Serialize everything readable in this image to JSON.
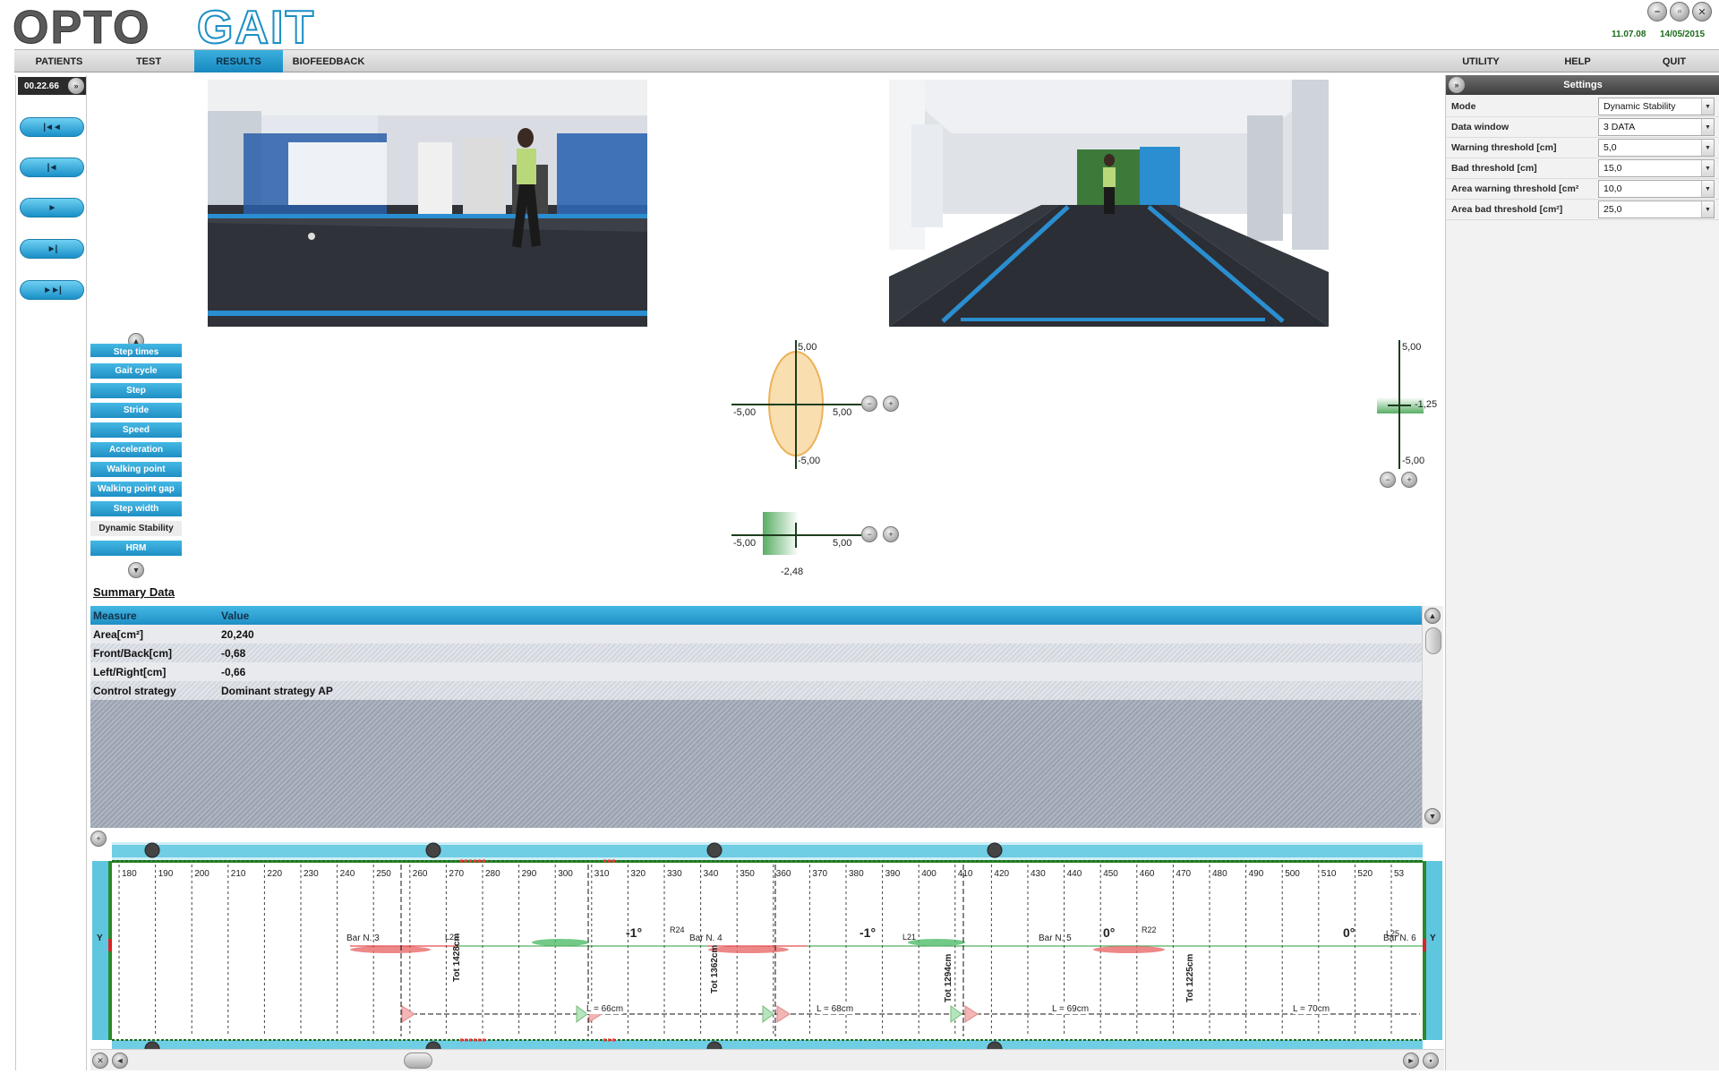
{
  "app": {
    "logo_text": "OPTOGAIT",
    "version": "11.07.08",
    "date": "14/05/2015"
  },
  "menu": {
    "left": [
      "PATIENTS",
      "TEST",
      "RESULTS",
      "BIOFEEDBACK"
    ],
    "right": [
      "UTILITY",
      "HELP",
      "QUIT"
    ],
    "active": "RESULTS"
  },
  "player": {
    "time": "00.22.66",
    "controls": [
      "|◄◄",
      "|◄",
      "►",
      "►|",
      "►►|"
    ]
  },
  "measures": {
    "items": [
      "Step times",
      "Gait cycle",
      "Step",
      "Stride",
      "Speed",
      "Acceleration",
      "Walking point",
      "Walking point gap",
      "Step width",
      "Dynamic Stability",
      "HRM"
    ],
    "selected": "Dynamic Stability"
  },
  "stability_plot": {
    "top": "5,00",
    "bottom": "-5,00",
    "left": "-5,00",
    "right": "5,00"
  },
  "lr_plot": {
    "left": "-5,00",
    "right": "5,00",
    "value": "-2,48"
  },
  "fb_plot": {
    "top": "5,00",
    "bottom": "-5,00",
    "value": "-1,25"
  },
  "settings": {
    "title": "Settings",
    "rows": [
      {
        "label": "Mode",
        "value": "Dynamic Stability"
      },
      {
        "label": "Data window",
        "value": "3 DATA"
      },
      {
        "label": "Warning threshold [cm]",
        "value": "5,0"
      },
      {
        "label": "Bad threshold [cm]",
        "value": "15,0"
      },
      {
        "label": "Area warning threshold [cm²",
        "value": "10,0"
      },
      {
        "label": "Area bad threshold [cm²]",
        "value": "25,0"
      }
    ]
  },
  "summary": {
    "title": "Summary Data",
    "headers": [
      "Measure",
      "Value"
    ],
    "rows": [
      [
        "Area[cm²]",
        "20,240"
      ],
      [
        "Front/Back[cm]",
        "-0,68"
      ],
      [
        "Left/Right[cm]",
        "-0,66"
      ],
      [
        "Control strategy",
        "Dominant strategy AP"
      ]
    ]
  },
  "track": {
    "ticks": [
      "180",
      "190",
      "200",
      "210",
      "220",
      "230",
      "240",
      "250",
      "260",
      "270",
      "280",
      "290",
      "300",
      "310",
      "320",
      "330",
      "340",
      "350",
      "360",
      "370",
      "380",
      "390",
      "400",
      "410",
      "420",
      "430",
      "440",
      "450",
      "460",
      "470",
      "480",
      "490",
      "500",
      "510",
      "520",
      "53"
    ],
    "bars": [
      "Bar N. 3",
      "Bar N. 4",
      "Bar N. 5",
      "Bar N. 6"
    ],
    "footprints": [
      "L23",
      "R24",
      "L21",
      "R22",
      "L25"
    ],
    "angles": [
      "-1°",
      "-1°",
      "0°",
      "0°"
    ],
    "totals": [
      "Tot 1428cm",
      "Tot 1362cm",
      "Tot 1294cm",
      "Tot 1225cm"
    ],
    "lengths": [
      "L = 66cm",
      "L = 68cm",
      "L = 69cm",
      "L = 70cm"
    ],
    "side_label": "Y"
  }
}
